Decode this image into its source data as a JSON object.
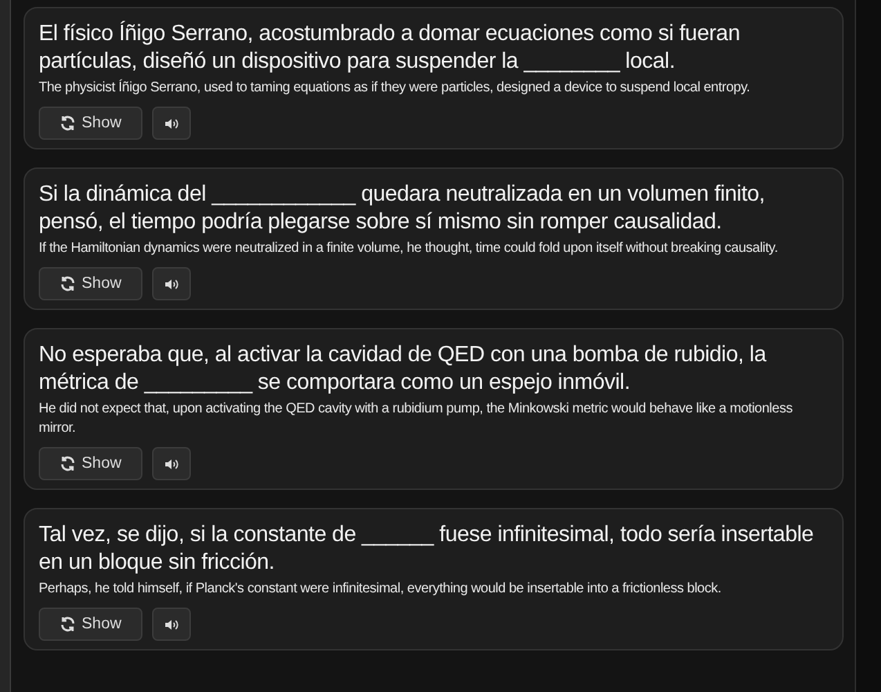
{
  "cards": [
    {
      "sentence": "El físico Íñigo Serrano, acostumbrado a domar ecuaciones como si fueran partículas, diseñó un dispositivo para suspender la ________ local.",
      "translation": "The physicist Íñigo Serrano, used to taming equations as if they were particles, designed a device to suspend local entropy.",
      "show_label": "Show"
    },
    {
      "sentence": "Si la dinámica del ____________ quedara neutralizada en un volumen finito, pensó, el tiempo podría plegarse sobre sí mismo sin romper causalidad.",
      "translation": "If the Hamiltonian dynamics were neutralized in a finite volume, he thought, time could fold upon itself without breaking causality.",
      "show_label": "Show"
    },
    {
      "sentence": "No esperaba que, al activar la cavidad de QED con una bomba de rubidio, la métrica de _________ se comportara como un espejo inmóvil.",
      "translation": "He did not expect that, upon activating the QED cavity with a rubidium pump, the Minkowski metric would behave like a motionless mirror.",
      "show_label": "Show"
    },
    {
      "sentence": "Tal vez, se dijo, si la constante de ______ fuese infinitesimal, todo sería insertable en un bloque sin fricción.",
      "translation": "Perhaps, he told himself, if Planck's constant were infinitesimal, everything would be insertable into a frictionless block.",
      "show_label": "Show"
    }
  ]
}
